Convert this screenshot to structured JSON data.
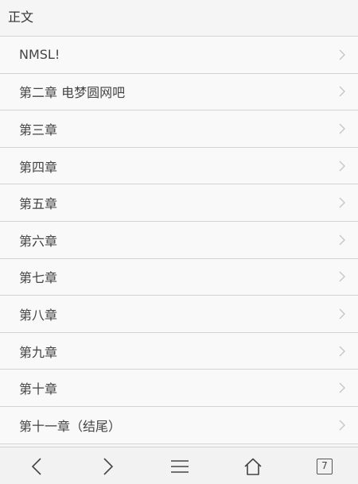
{
  "section": {
    "title": "正文"
  },
  "chapters": [
    {
      "label": "NMSL!"
    },
    {
      "label": "第二章 电梦圆网吧"
    },
    {
      "label": "第三章"
    },
    {
      "label": "第四章"
    },
    {
      "label": "第五章"
    },
    {
      "label": "第六章"
    },
    {
      "label": "第七章"
    },
    {
      "label": "第八章"
    },
    {
      "label": "第九章"
    },
    {
      "label": "第十章"
    },
    {
      "label": "第十一章（结尾）"
    }
  ],
  "toolbar": {
    "back_icon": "chevron-left-icon",
    "forward_icon": "chevron-right-icon",
    "menu_icon": "menu-icon",
    "home_icon": "home-icon",
    "tabs_count": "7"
  }
}
